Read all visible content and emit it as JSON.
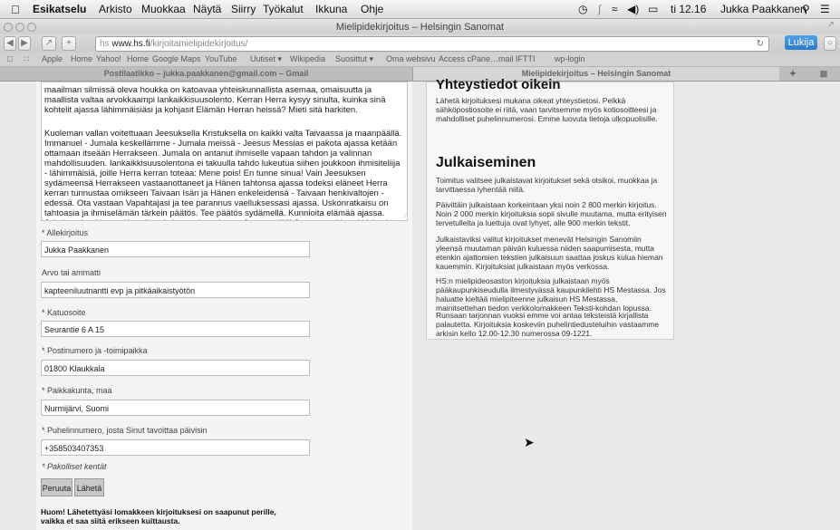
{
  "menubar": {
    "apple": "",
    "app": "Esikatselu",
    "items": [
      "Arkisto",
      "Muokkaa",
      "Näytä",
      "Siirry",
      "Työkalut",
      "Ikkuna",
      "Ohje"
    ],
    "clock": "ti 12.16",
    "user": "Jukka Paakkanen"
  },
  "window": {
    "title": "Mielipidekirjoitus – Helsingin Sanomat"
  },
  "toolbar": {
    "url_prefix": "www.hs.fi",
    "url_path": "/kirjoitamielipidekirjoitus/",
    "reader": "Lukija"
  },
  "bookmarks": [
    "Apple",
    "Home",
    "Yahoo!",
    "Home",
    "Google Maps",
    "YouTube",
    "Uutiset ▾",
    "Wikipedia",
    "Suosittut ▾",
    "Oma websivu",
    "Access cPane…mail IFTTI",
    "wp-login"
  ],
  "tabs": [
    "Postilaatikko – jukka.paakkanen@gmail.com – Gmail",
    "Mielipidekirjoitus – Helsingin Sanomat"
  ],
  "letter": {
    "para1": "maailman silmissä oleva houkka on katoavaa yhteiskunnallista asemaa, omaisuutta ja maallista valtaa arvokkaampi lankaikkisuusolento. Kerran Herra kysyy sinulta, kuinka sinä kohtelit ajassa lähimmäisiäsi ja kohjasit Elämän Herran heissä? Mieti sitä harkiten.",
    "para2": "Kuoleman vallan voitettuaan Jeesuksella Kristuksella on kaikki valta Taivaassa ja maanpäällä. Immanuel - Jumala keskellämme - Jumala meissä - Jeesus Messias ei pakota ajassa ketään ottamaan itseään Herrakseen. Jumala on antanut ihmiselle vapaan tahdon ja valinnan mahdollisuuden. Iankaikkisuusolentona ei takuulla tahdo lukeutua siihen joukkoon ihmisiteliija - lähimmäisiä, joille Herra kerran toteaa: Mene pois! En tunne sinua! Vain Jeesuksen sydämeensä Herrakseen vastaanottaneet ja Hänen tahtonsa ajassa todeksi eläneet Herra kerran tunnustaa omikseen Taivaan Isän ja Hänen enkeleidensä - Taivaan henkivaltojen - edessä. Ota vastaan Vapahtajasi ja tee parannus vaelluksessasi ajassa. Uskonratkaisu on tahtoasia ja ihmiselämän tärkein päätös. Tee päätös sydämellä. Kunnioita elämää ajassa. Jokainen houkka on Herralle erityisen rakas ajassa. Jeesus elää! Jeesus on Herra! Valoa ja iloa."
  },
  "form": {
    "signature_label": "* Allekirjoitus",
    "signature_value": "Jukka Paakkanen",
    "title_label": "Arvo tai ammatti",
    "title_value": "kapteeniluutnantti evp ja pitkäaikaistyötön",
    "street_label": "* Katuosoite",
    "street_value": "Seurantie 6 A 15",
    "postal_label": "* Postinumero ja -toimipaikka",
    "postal_value": "01800 Klaukkala",
    "municipality_label": "* Paikkakunta, maa",
    "municipality_value": "Nurmijärvi, Suomi",
    "phone_label": "* Puhelinnumero, josta Sinut tavoittaa päivisin",
    "phone_value": "+358503407353",
    "required_note": "* Pakolliset kentät",
    "cancel": "Peruuta",
    "send": "Lähetä",
    "notice": "Huom! Lähetettyäsi lomakkeen kirjoituksesi on saapunut perille, vaikka et saa siitä erikseen kuittausta."
  },
  "sidebar": {
    "h1": "Yhteystiedot oikein",
    "p1": "Lähetä kirjoituksesi mukana oikeat yhteystietosi. Pelkkä sähköpostiosoite ei riitä, vaan tarvitsemme myös kotiosoitteesi ja mahdolliset puhelinnumerosi. Emme luovuta tietoja ulkopuolisille.",
    "h2": "Julkaiseminen",
    "p2": "Toimitus valitsee julkaistavat kirjoitukset sekä otsikoi, muokkaa ja tarvittaessa lyhentää niitä.",
    "p3": "Päivittäin julkaistaan korkeintaan yksi noin 2 800 merkin kirjoitus. Noin 2 000 merkin kirjoituksia sopii sivulle muutama, mutta erityisen tervetulleita ja luettuja ovat lyhyet, alle 900 merkin tekstit.",
    "p4": "Julkaistaviksi valitut kirjoitukset menevät Helsingin Sanomiin yleensä muutaman päivän kuluessa niiden saapumisesta, mutta etenkin ajattomien tekstien julkaisuun saattaa joskus kulua hieman kauemmin. Kirjoituksiat julkaistaan myös verkossa.",
    "p5": "HS:n mielipideosaston kirjoituksia julkaistaan myös pääkaupunkiseudulla ilmestyvässä kaupunkilehti HS Mestassa. Jos haluatte kieltää mielipiteenne julkaisun HS Mestassa, mainitsettehan tiedon verkkolomakkeen Teksti-kohdan lopussa.",
    "p6": "Runsaan tarjonnan vuoksi emme voi antaa teksteistä kirjallista palautetta. Kirjoituksia koskeviin puhelintiedusteluihin vastaamme arkisin kello 12.00-12.30 numerossa 09-1221."
  }
}
